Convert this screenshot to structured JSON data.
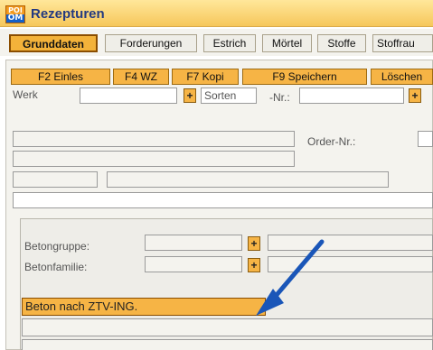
{
  "window": {
    "title": "Rezepturen",
    "icon_text_top": "POI",
    "icon_text_bottom": "OM"
  },
  "tabs": [
    {
      "label": "Grunddaten",
      "active": true
    },
    {
      "label": "Forderungen"
    },
    {
      "label": "Estrich"
    },
    {
      "label": "Mörtel"
    },
    {
      "label": "Stoffe"
    },
    {
      "label": "Stoffrau"
    }
  ],
  "function_buttons": [
    "F2 Einles",
    "F4 WZ",
    "F7 Kopi",
    "F9 Speichern",
    "Löschen"
  ],
  "fields": {
    "werk_label": "Werk",
    "werk_value": "",
    "sorten_label": "Sorten",
    "nr_label": "-Nr.:",
    "nr_value": "",
    "order_label": "Order-Nr.:",
    "order_value": ""
  },
  "group": {
    "betongruppe_label": "Betongruppe:",
    "betonfamilie_label": "Betonfamilie:",
    "betongruppe_value": "",
    "betonfamilie_value": "",
    "highlight_value": "Beton nach ZTV-ING."
  },
  "colors": {
    "accent": "#f6b445",
    "arrow": "#1a56b8",
    "title": "#243a80"
  }
}
